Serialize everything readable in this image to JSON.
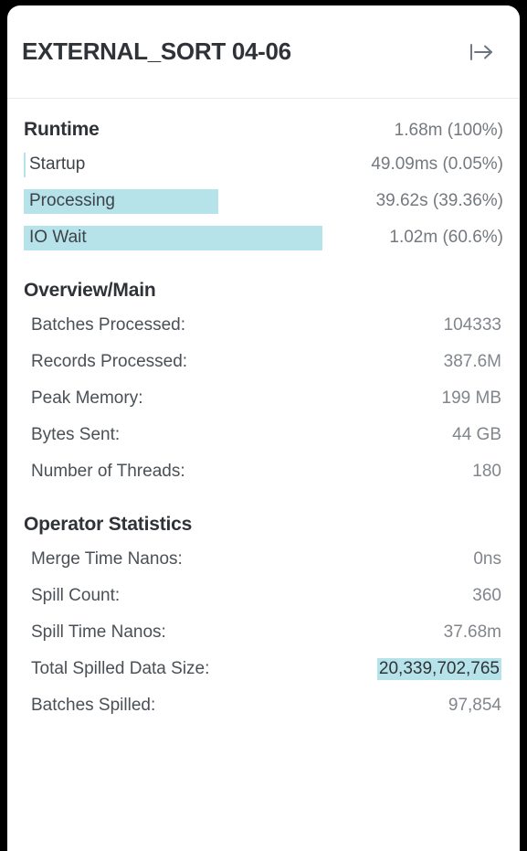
{
  "header": {
    "title": "EXTERNAL_SORT 04-06",
    "action_icon": "arrow-right-to-bar-icon"
  },
  "runtime": {
    "title": "Runtime",
    "total": "1.68m (100%)",
    "bar_color": "#b6e2e9",
    "rows": [
      {
        "label": "Startup",
        "value": "49.09ms (0.05%)",
        "percent": 0.05
      },
      {
        "label": "Processing",
        "value": "39.62s (39.36%)",
        "percent": 39.36
      },
      {
        "label": "IO Wait",
        "value": "1.02m (60.6%)",
        "percent": 60.6
      }
    ]
  },
  "overview": {
    "title": "Overview/Main",
    "rows": [
      {
        "label": "Batches Processed:",
        "value": "104333"
      },
      {
        "label": "Records Processed:",
        "value": "387.6M"
      },
      {
        "label": "Peak Memory:",
        "value": "199 MB"
      },
      {
        "label": "Bytes Sent:",
        "value": "44 GB"
      },
      {
        "label": "Number of Threads:",
        "value": "180"
      }
    ]
  },
  "operator_statistics": {
    "title": "Operator Statistics",
    "rows": [
      {
        "label": "Merge Time Nanos:",
        "value": "0ns",
        "highlight": false
      },
      {
        "label": "Spill Count:",
        "value": "360",
        "highlight": false
      },
      {
        "label": "Spill Time Nanos:",
        "value": "37.68m",
        "highlight": false
      },
      {
        "label": "Total Spilled Data Size:",
        "value": "20,339,702,765",
        "highlight": true
      },
      {
        "label": "Batches Spilled:",
        "value": "97,854",
        "highlight": false
      }
    ]
  }
}
